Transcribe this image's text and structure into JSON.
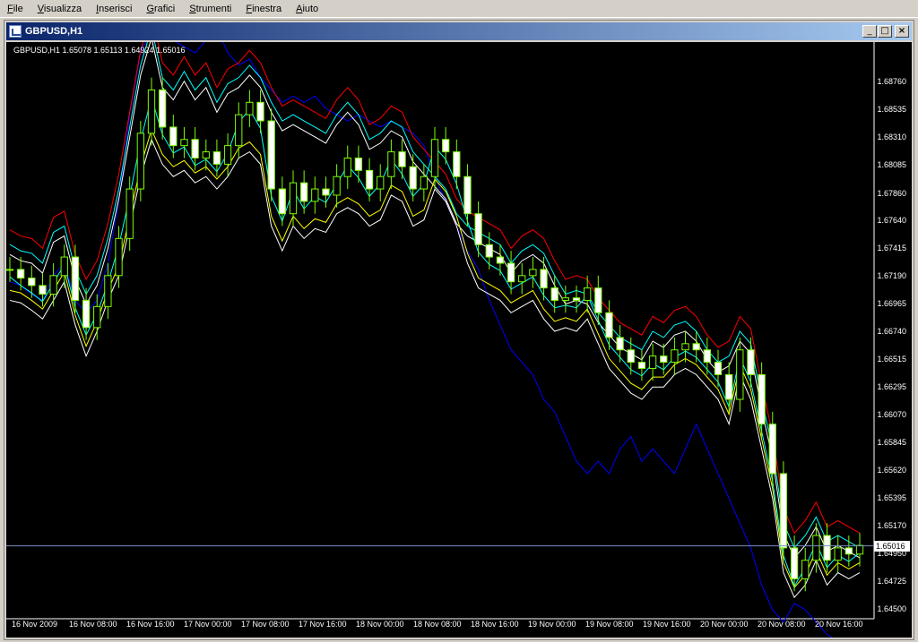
{
  "menu": [
    "File",
    "Visualizza",
    "Inserisci",
    "Grafici",
    "Strumenti",
    "Finestra",
    "Aiuto"
  ],
  "window": {
    "title": "GBPUSD,H1",
    "min_label": "_",
    "max_label": "□",
    "close_label": "×"
  },
  "chart_data": {
    "type": "candlestick",
    "info_line": "GBPUSD,H1  1.65078 1.65113 1.64924 1.65016",
    "symbol": "GBPUSD,H1",
    "current_price": "1.65016",
    "y_ticks": [
      "1.68760",
      "1.68535",
      "1.68310",
      "1.68085",
      "1.67860",
      "1.67640",
      "1.67415",
      "1.67190",
      "1.66965",
      "1.66740",
      "1.66515",
      "1.66295",
      "1.66070",
      "1.65845",
      "1.65620",
      "1.65395",
      "1.65170",
      "1.64950",
      "1.64725",
      "1.64500"
    ],
    "x_ticks": [
      "16 Nov 2009",
      "16 Nov 08:00",
      "16 Nov 16:00",
      "17 Nov 00:00",
      "17 Nov 08:00",
      "17 Nov 16:00",
      "18 Nov 00:00",
      "18 Nov 08:00",
      "18 Nov 16:00",
      "19 Nov 00:00",
      "19 Nov 08:00",
      "19 Nov 16:00",
      "20 Nov 00:00",
      "20 Nov 08:00",
      "20 Nov 16:00"
    ],
    "ylim": [
      1.645,
      1.69
    ],
    "close": [
      1.6725,
      1.6718,
      1.6712,
      1.6705,
      1.672,
      1.6735,
      1.67,
      1.6678,
      1.6695,
      1.672,
      1.675,
      1.679,
      1.6835,
      1.687,
      1.684,
      1.6825,
      1.683,
      1.6815,
      1.682,
      1.681,
      1.6825,
      1.685,
      1.686,
      1.6845,
      1.679,
      1.677,
      1.6795,
      1.678,
      1.679,
      1.6785,
      1.68,
      1.6815,
      1.6805,
      1.679,
      1.68,
      1.682,
      1.6808,
      1.679,
      1.68,
      1.683,
      1.682,
      1.68,
      1.677,
      1.6745,
      1.6735,
      1.673,
      1.6715,
      1.672,
      1.6725,
      1.671,
      1.67,
      1.6702,
      1.67,
      1.671,
      1.669,
      1.667,
      1.666,
      1.665,
      1.6645,
      1.6655,
      1.665,
      1.666,
      1.6665,
      1.666,
      1.665,
      1.664,
      1.662,
      1.666,
      1.664,
      1.66,
      1.656,
      1.65,
      1.6475,
      1.649,
      1.651,
      1.649,
      1.65,
      1.6495,
      1.6502
    ],
    "upper_envelope": [
      1.6745,
      1.674,
      1.6738,
      1.673,
      1.6755,
      1.676,
      1.6725,
      1.6705,
      1.672,
      1.675,
      1.679,
      1.684,
      1.689,
      1.692,
      1.688,
      1.687,
      1.6885,
      1.687,
      1.688,
      1.686,
      1.6875,
      1.688,
      1.689,
      1.688,
      1.686,
      1.6845,
      1.685,
      1.6845,
      1.684,
      1.6835,
      1.685,
      1.686,
      1.685,
      1.683,
      1.6835,
      1.6845,
      1.684,
      1.682,
      1.681,
      1.68,
      1.679,
      1.677,
      1.676,
      1.6755,
      1.675,
      1.6745,
      1.673,
      1.674,
      1.6745,
      1.6738,
      1.672,
      1.6705,
      1.6708,
      1.6705,
      1.669,
      1.668,
      1.667,
      1.6665,
      1.666,
      1.6675,
      1.667,
      1.668,
      1.6683,
      1.6675,
      1.666,
      1.665,
      1.6655,
      1.6675,
      1.6665,
      1.662,
      1.658,
      1.652,
      1.65,
      1.651,
      1.6525,
      1.6505,
      1.651,
      1.6505,
      1.65
    ],
    "lower_envelope": [
      1.67,
      1.6698,
      1.6692,
      1.6685,
      1.67,
      1.6715,
      1.668,
      1.6655,
      1.6675,
      1.67,
      1.672,
      1.676,
      1.68,
      1.683,
      1.681,
      1.68,
      1.6805,
      1.6795,
      1.68,
      1.679,
      1.68,
      1.6815,
      1.682,
      1.681,
      1.676,
      1.674,
      1.676,
      1.675,
      1.6758,
      1.6755,
      1.677,
      1.6775,
      1.677,
      1.676,
      1.6765,
      1.6785,
      1.678,
      1.676,
      1.6765,
      1.679,
      1.678,
      1.676,
      1.673,
      1.671,
      1.6705,
      1.67,
      1.669,
      1.6695,
      1.67,
      1.6685,
      1.6675,
      1.6678,
      1.6675,
      1.6685,
      1.6665,
      1.6645,
      1.6635,
      1.6625,
      1.662,
      1.663,
      1.663,
      1.664,
      1.6645,
      1.664,
      1.663,
      1.662,
      1.66,
      1.664,
      1.662,
      1.658,
      1.654,
      1.648,
      1.646,
      1.647,
      1.649,
      1.647,
      1.648,
      1.6475,
      1.648
    ],
    "blue_line": [
      1.6715,
      1.6712,
      1.6705,
      1.67,
      1.672,
      1.673,
      1.67,
      1.669,
      1.67,
      1.673,
      1.678,
      1.685,
      1.69,
      1.692,
      1.6915,
      1.691,
      1.6905,
      1.69,
      1.691,
      1.692,
      1.69,
      1.689,
      1.6895,
      1.688,
      1.687,
      1.686,
      1.6865,
      1.686,
      1.6865,
      1.6855,
      1.685,
      1.6845,
      1.685,
      1.6845,
      1.684,
      1.6845,
      1.684,
      1.6835,
      1.6825,
      1.68,
      1.678,
      1.676,
      1.674,
      1.6725,
      1.67,
      1.668,
      1.666,
      1.665,
      1.664,
      1.662,
      1.661,
      1.659,
      1.657,
      1.656,
      1.657,
      1.656,
      1.658,
      1.659,
      1.657,
      1.658,
      1.657,
      1.656,
      1.658,
      1.66,
      1.658,
      1.656,
      1.654,
      1.652,
      1.65,
      1.647,
      1.645,
      1.644,
      1.6455,
      1.645,
      1.644,
      1.643,
      1.6425,
      1.642,
      1.642
    ],
    "colors": {
      "background": "#000000",
      "candle": "#7cfc00",
      "envelope": "#ffffff",
      "upper_band": "#ff0000",
      "lower_band": "#0000ff",
      "mid_band": "#ffff00",
      "cyan_band": "#00ffff",
      "price_line": "#7090c0"
    },
    "grid": false
  }
}
